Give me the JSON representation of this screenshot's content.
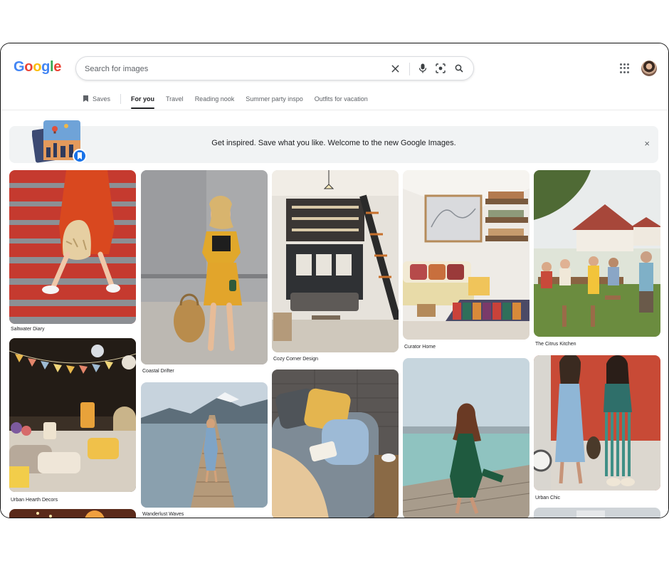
{
  "header": {
    "logo_letters": [
      {
        "ch": "G",
        "color": "#4285F4"
      },
      {
        "ch": "o",
        "color": "#EA4335"
      },
      {
        "ch": "o",
        "color": "#FBBC05"
      },
      {
        "ch": "g",
        "color": "#4285F4"
      },
      {
        "ch": "l",
        "color": "#34A853"
      },
      {
        "ch": "e",
        "color": "#EA4335"
      }
    ],
    "search": {
      "placeholder": "Search for images",
      "value": ""
    }
  },
  "tabs": [
    {
      "label": "Saves",
      "active": false
    },
    {
      "label": "For you",
      "active": true
    },
    {
      "label": "Travel",
      "active": false
    },
    {
      "label": "Reading nook",
      "active": false
    },
    {
      "label": "Summer party inspo",
      "active": false
    },
    {
      "label": "Outfits for vacation",
      "active": false
    }
  ],
  "banner": {
    "text": "Get inspired. Save what you like. Welcome to the new Google Images.",
    "close_glyph": "×"
  },
  "tiles": [
    {
      "caption": "Saltwater Diary",
      "theme": "red-stairs"
    },
    {
      "caption": "Urban Hearth Decors",
      "theme": "party-lounge"
    },
    {
      "caption": "",
      "theme": "sunset"
    },
    {
      "caption": "Coastal Drifter",
      "theme": "yellow-outfit"
    },
    {
      "caption": "Wanderlust Waves",
      "theme": "pier-mountains"
    },
    {
      "caption": "Cozy Corner Design",
      "theme": "loft-interior"
    },
    {
      "caption": "",
      "theme": "cozy-chair"
    },
    {
      "caption": "Curator Home",
      "theme": "sofa-room"
    },
    {
      "caption": "",
      "theme": "green-dress-pier"
    },
    {
      "caption": "The Citrus Kitchen",
      "theme": "garden-party"
    },
    {
      "caption": "Urban Chic",
      "theme": "two-friends"
    },
    {
      "caption": "",
      "theme": "cropped"
    }
  ]
}
